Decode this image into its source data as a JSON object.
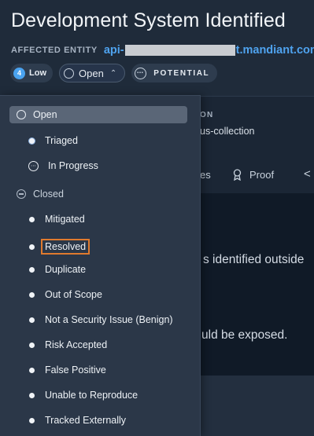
{
  "header": {
    "title": "Development System Identified",
    "entity_label": "AFFECTED ENTITY",
    "entity_prefix": "api-",
    "entity_suffix": "t.mandiant.com"
  },
  "chips": {
    "severity_number": "4",
    "severity_label": "Low",
    "status_label": "Open",
    "classification_label": "POTENTIAL"
  },
  "background": {
    "info_label": "ON",
    "info_value": "us-collection",
    "tab_partial": "es",
    "tab_proof": "Proof",
    "prev_arrow": "<",
    "content_line1": "s identified outside",
    "content_line2": "uld be exposed."
  },
  "dropdown": {
    "open": "Open",
    "triaged": "Triaged",
    "in_progress": "In Progress",
    "closed": "Closed",
    "items": [
      "Mitigated",
      "Resolved",
      "Duplicate",
      "Out of Scope",
      "Not a Security Issue (Benign)",
      "Risk Accepted",
      "False Positive",
      "Unable to Reproduce",
      "Tracked Externally"
    ]
  },
  "colors": {
    "background": "#1f2b3a",
    "link": "#4fa3ef",
    "highlight": "#e07a2e",
    "dropdown_bg": "#2b3748",
    "selected_bg": "#5a6677"
  }
}
